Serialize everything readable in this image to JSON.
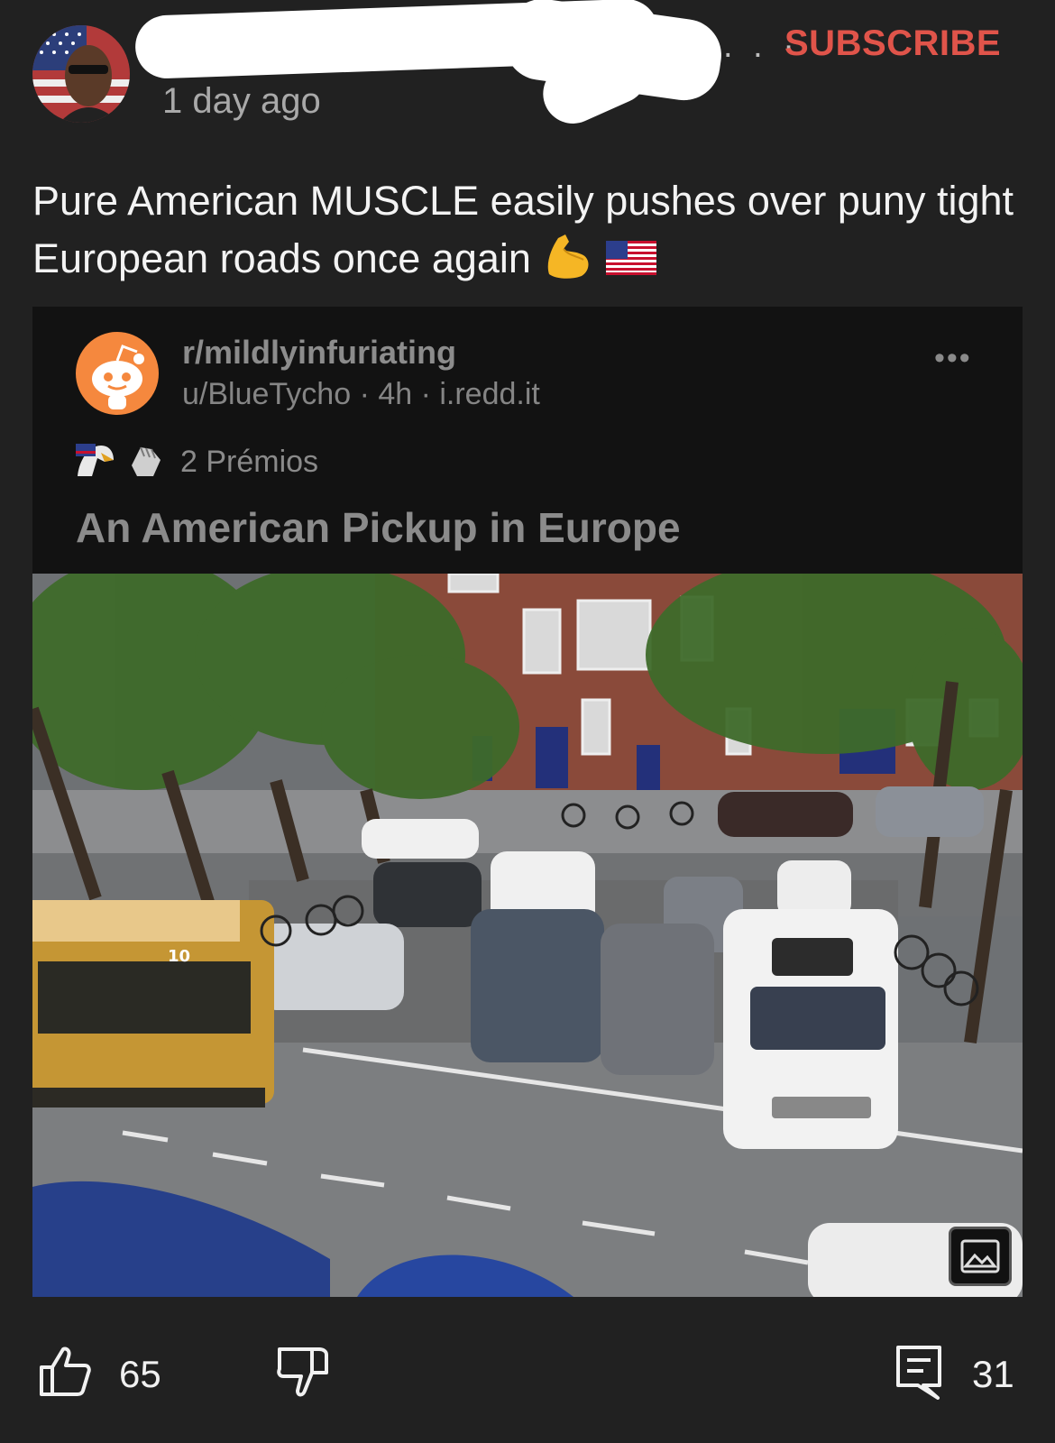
{
  "header": {
    "author_visible": "",
    "dots": ". . ·",
    "subscribe_label": "SUBSCRIBE",
    "time": "1 day ago"
  },
  "post": {
    "text": "Pure American MUSCLE easily pushes over puny tight European roads once again"
  },
  "embed": {
    "subreddit": "r/mildlyinfuriating",
    "meta": "u/BlueTycho · 4h · i.redd.it",
    "more": "•••",
    "awards_label": "2 Prémios",
    "title": "An American Pickup in Europe",
    "tram_number": "10"
  },
  "actions": {
    "like_count": "65",
    "comment_count": "31"
  },
  "colors": {
    "background": "#212121",
    "subscribe": "#e0544a",
    "reddit_orange": "#f5883e"
  }
}
